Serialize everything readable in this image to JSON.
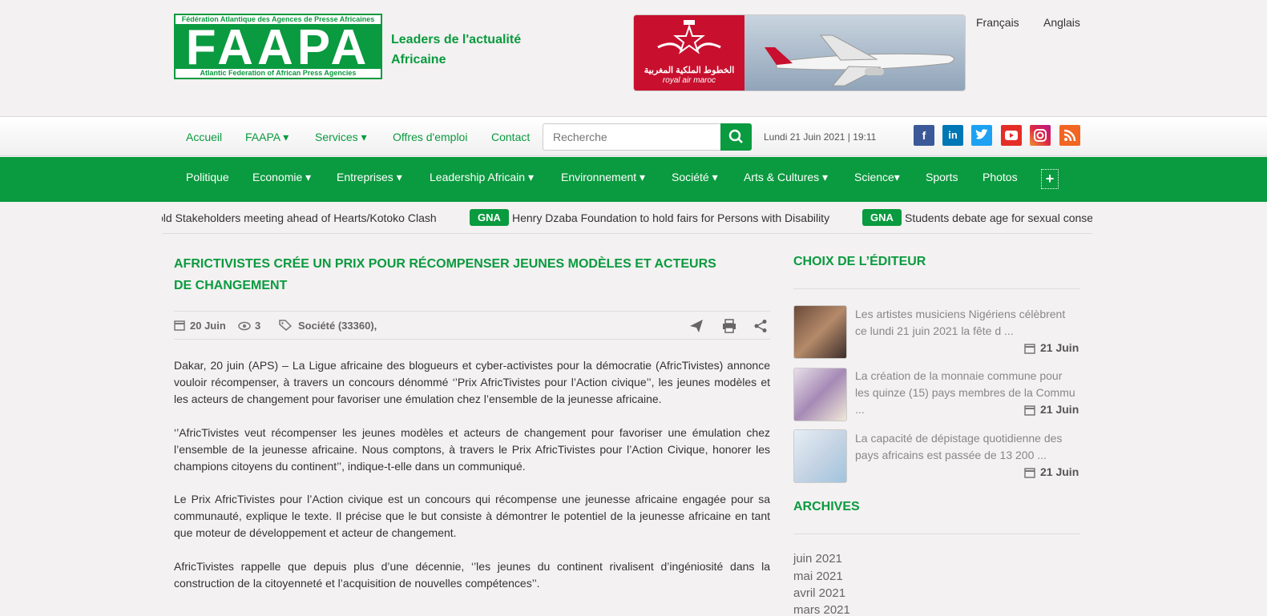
{
  "header": {
    "logo_top": "Fédération Atlantique des Agences de Presse Africaines",
    "logo_main": "FAAPA",
    "logo_bottom": "Atlantic Federation of African Press Agencies",
    "tagline_1": "Leaders de l'actualité",
    "tagline_2": "Africaine",
    "ad": {
      "arabic": "الخطوط الملكية المغربية",
      "name": "royal air maroc"
    },
    "languages": [
      "Français",
      "Anglais"
    ]
  },
  "nav1": {
    "items": [
      "Accueil",
      "FAAPA ▾",
      "Services ▾",
      "Offres d'emploi",
      "Contact"
    ],
    "search_placeholder": "Recherche",
    "date": "Lundi 21 Juin 2021 | 19:11",
    "social": [
      "facebook-icon",
      "linkedin-icon",
      "twitter-icon",
      "youtube-icon",
      "instagram-icon",
      "rss-icon"
    ]
  },
  "nav2": {
    "items": [
      "Politique",
      "Economie ▾",
      "Entreprises ▾",
      "Leadership Africain ▾",
      "Environnement ▾",
      "Société ▾",
      "Arts & Cultures ▾",
      "Science▾",
      "Sports",
      "Photos"
    ],
    "plus": "+"
  },
  "ticker": {
    "items": [
      {
        "badge": "",
        "text": "old Stakeholders meeting ahead of Hearts/Kotoko Clash"
      },
      {
        "badge": "GNA",
        "text": "Henry Dzaba Foundation to hold fairs for Persons with Disability"
      },
      {
        "badge": "GNA",
        "text": "Students debate age for sexual conse"
      }
    ]
  },
  "article": {
    "title": "AFRICTIVISTES CRÉE UN PRIX POUR RÉCOMPENSER JEUNES MODÈLES ET ACTEURS DE CHANGEMENT",
    "date": "20 Juin",
    "views": "3",
    "category": "Société (33360),",
    "paragraphs": [
      "Dakar, 20 juin (APS) – La Ligue africaine des blogueurs et cyber-activistes pour la démocratie (AfricTivistes) annonce vouloir récompenser, à travers un concours dénommé ‘’Prix AfricTivistes pour l’Action civique’’, les jeunes modèles et les acteurs de changement pour favoriser une émulation chez l’ensemble de la jeunesse africaine.",
      "‘’AfricTivistes veut récompenser les jeunes modèles et acteurs de changement pour favoriser une émulation chez l’ensemble de la jeunesse africaine. Nous comptons, à travers le Prix AfricTivistes pour l’Action Civique, honorer les champions citoyens du continent’’, indique-t-elle dans un communiqué.",
      "Le Prix AfricTivistes pour l’Action civique est un concours qui récompense une jeunesse africaine engagée pour sa communauté, explique le texte. Il précise que le but consiste à démontrer le potentiel de la jeunesse africaine en tant que moteur de développement et acteur de changement.",
      "AfricTivistes rappelle que depuis plus d’une décennie, ‘’les jeunes du continent rivalisent d’ingéniosité dans la construction de la citoyenneté et l’acquisition de nouvelles compétences’’."
    ]
  },
  "sidebar": {
    "editor_heading": "CHOIX DE L’ÉDITEUR",
    "picks": [
      {
        "text": "Les artistes musiciens Nigériens célèbrent ce lundi 21 juin 2021 la fête d ...",
        "date": "21 Juin"
      },
      {
        "text": "La création de la monnaie commune pour les quinze (15) pays membres de la Commu ...",
        "date": "21 Juin"
      },
      {
        "text": "La capacité de dépistage quotidienne des pays africains est passée de 13 200 ...",
        "date": "21 Juin"
      }
    ],
    "archives_heading": "ARCHIVES",
    "archives": [
      "juin 2021",
      "mai 2021",
      "avril 2021",
      "mars 2021"
    ]
  }
}
